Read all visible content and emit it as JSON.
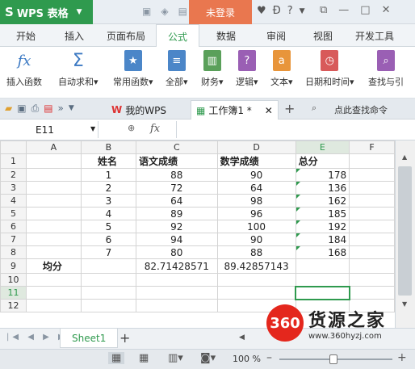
{
  "app": {
    "title": "WPS 表格",
    "login_label": "未登录"
  },
  "ribbon_tabs": [
    "开始",
    "插入",
    "页面布局",
    "公式",
    "数据",
    "审阅",
    "视图",
    "开发工具"
  ],
  "ribbon_buttons": [
    {
      "label": "插入函数",
      "icon": "fx-icon",
      "color": "#3b79c3"
    },
    {
      "label": "自动求和",
      "icon": "sigma-icon",
      "color": "#3b79c3"
    },
    {
      "label": "常用函数",
      "icon": "star-book-icon",
      "color": "#4b86c8"
    },
    {
      "label": "全部",
      "icon": "list-book-icon",
      "color": "#4b86c8"
    },
    {
      "label": "财务",
      "icon": "finance-book-icon",
      "color": "#5aa05a"
    },
    {
      "label": "逻辑",
      "icon": "question-book-icon",
      "color": "#9a5fb4"
    },
    {
      "label": "文本",
      "icon": "a-book-icon",
      "color": "#e8953b"
    },
    {
      "label": "日期和时间",
      "icon": "clock-book-icon",
      "color": "#d85a5a"
    },
    {
      "label": "查找与引",
      "icon": "search-book-icon",
      "color": "#9a5fb4"
    }
  ],
  "doc_tabs": [
    {
      "label": "我的WPS",
      "icon": "wps-w-icon"
    },
    {
      "label": "工作簿1 *",
      "icon": "sheet-doc-icon"
    }
  ],
  "search_label": "点此查找命令",
  "formula": {
    "cell_ref": "E11",
    "fx": "fx",
    "content": ""
  },
  "columns": [
    "A",
    "B",
    "C",
    "D",
    "E",
    "F"
  ],
  "rows": [
    {
      "n": "1",
      "cells": [
        "",
        "姓名",
        "语文成绩",
        "数学成绩",
        "总分",
        ""
      ]
    },
    {
      "n": "2",
      "cells": [
        "",
        "1",
        "88",
        "90",
        "178",
        ""
      ]
    },
    {
      "n": "3",
      "cells": [
        "",
        "2",
        "72",
        "64",
        "136",
        ""
      ]
    },
    {
      "n": "4",
      "cells": [
        "",
        "3",
        "64",
        "98",
        "162",
        ""
      ]
    },
    {
      "n": "5",
      "cells": [
        "",
        "4",
        "89",
        "96",
        "185",
        ""
      ]
    },
    {
      "n": "6",
      "cells": [
        "",
        "5",
        "92",
        "100",
        "192",
        ""
      ]
    },
    {
      "n": "7",
      "cells": [
        "",
        "6",
        "94",
        "90",
        "184",
        ""
      ]
    },
    {
      "n": "8",
      "cells": [
        "",
        "7",
        "80",
        "88",
        "168",
        ""
      ]
    },
    {
      "n": "9",
      "cells": [
        "均分",
        "",
        "82.71428571",
        "89.42857143",
        "",
        ""
      ]
    },
    {
      "n": "10",
      "cells": [
        "",
        "",
        "",
        "",
        "",
        ""
      ]
    },
    {
      "n": "11",
      "cells": [
        "",
        "",
        "",
        "",
        "",
        ""
      ]
    },
    {
      "n": "12",
      "cells": [
        "",
        "",
        "",
        "",
        "",
        ""
      ]
    }
  ],
  "sheet_tab": "Sheet1",
  "zoom": "100 %",
  "watermark": {
    "badge": "360",
    "title": "货源之家",
    "url": "www.360hyzj.com"
  }
}
